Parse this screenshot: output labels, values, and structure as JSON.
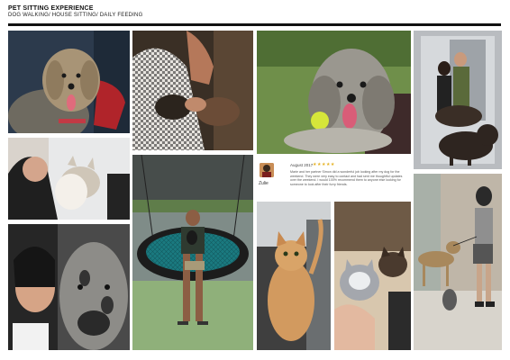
{
  "header": {
    "title": "PET SITTING EXPERIENCE",
    "subtitle": "DOG WALKING/ HOUSE SITTING/ DAILY FEEDING"
  },
  "review": {
    "date": "August 2017",
    "stars": "★★★★★",
    "rating": 5,
    "text": "Marie and her partner Simon did a wonderful job looking after my dog for the weekend. They were very easy to contact and had sent me thoughtful updates over the weekend. I would 100% recommend them to anyone else looking for someone to look after their furry friends.",
    "reviewer": "Zulie"
  },
  "colors": {
    "header_rule": "#111111",
    "star": "#e5b325",
    "background": "#ffffff"
  }
}
